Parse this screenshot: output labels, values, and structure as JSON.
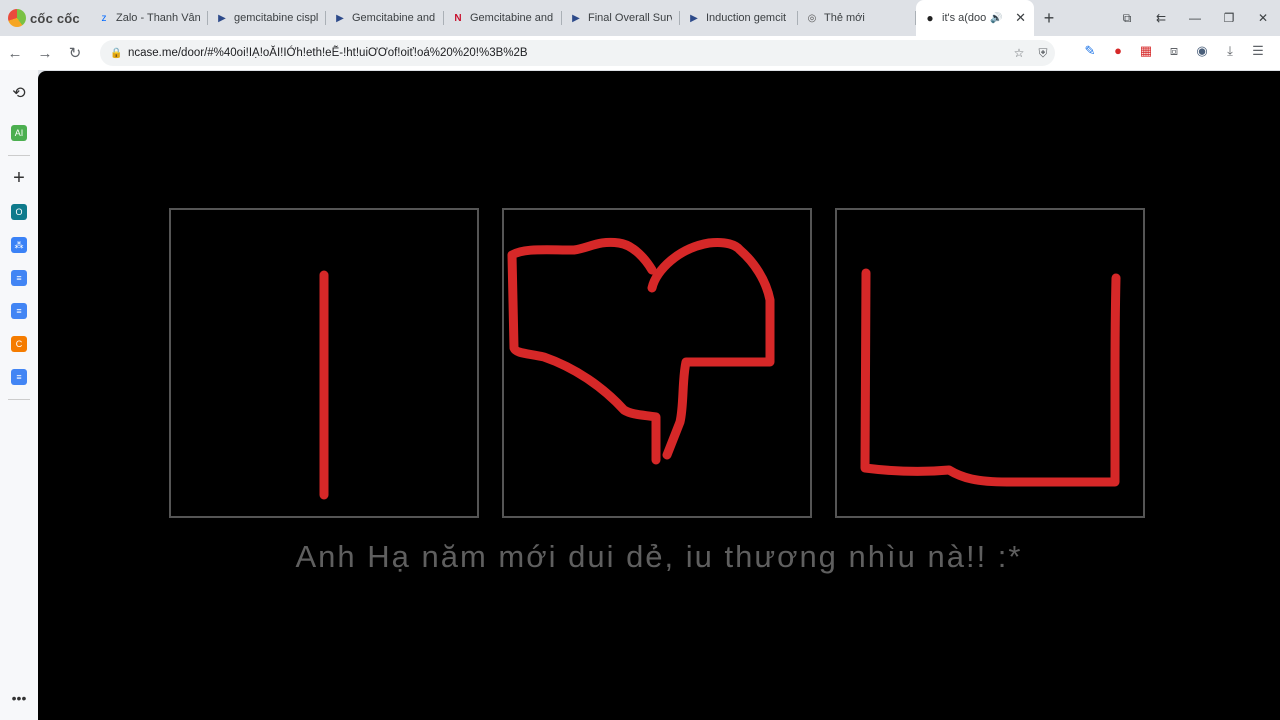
{
  "browser": {
    "brand": "cốc cốc",
    "tabs": [
      {
        "title": "Zalo - Thanh Vân"
      },
      {
        "title": "gemcitabine cispl"
      },
      {
        "title": "Gemcitabine and"
      },
      {
        "title": "Gemcitabine and"
      },
      {
        "title": "Final Overall Surv"
      },
      {
        "title": "Induction gemcit"
      },
      {
        "title": "Thẻ mới"
      },
      {
        "title": "it's a(doo"
      }
    ],
    "url": "ncase.me/door/#%40oi!IẠ!oĂI!IỚh!eth!eẼ-!ht!uiƠƠof!oiť!oá%20%20!%3B%2B"
  },
  "page": {
    "caption": "Anh Hạ năm mới dui dẻ, iu thương nhìu nà!! :*"
  },
  "colors": {
    "stroke": "#d62828",
    "panel_border": "#555555",
    "caption": "#5f5f5f"
  }
}
